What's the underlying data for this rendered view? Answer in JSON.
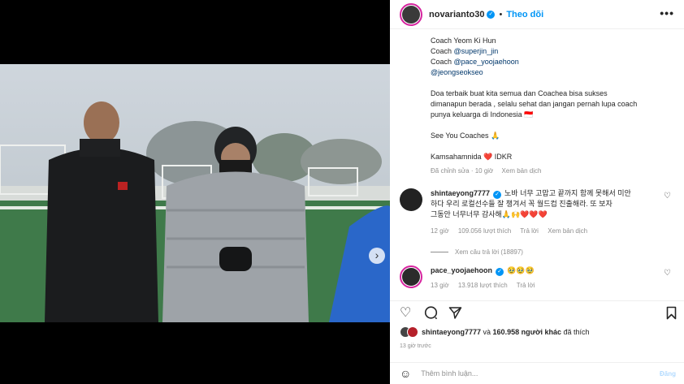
{
  "post": {
    "username": "novarianto30",
    "verified": true,
    "separator": "•",
    "follow_label": "Theo dõi",
    "more_label": "•••"
  },
  "caption": {
    "lines": [
      {
        "text": "Coach Yeom Ki Hun",
        "mention": false
      },
      {
        "text": "Coach ",
        "mention": false,
        "handle": "@superjin_jin"
      },
      {
        "text": "Coach ",
        "mention": false,
        "handle": "@pace_yoojaehoon"
      },
      {
        "text": "",
        "mention": true,
        "handle": "@jeongseokseo"
      }
    ],
    "paragraph_1": "Doa terbaik buat kita semua dan Coachea bisa sukses",
    "paragraph_2": "dimanapun berada , selalu sehat dan jangan pernah lupa coach",
    "paragraph_3": "punya keluarga di Indonesia 🇮🇩",
    "see_you": "See You Coaches 🙏",
    "kamsa": "Kamsahamnida ❤️ IDKR",
    "meta_edited": "Đã chỉnh sửa · 10 giờ",
    "meta_translate": "Xem bản dịch"
  },
  "comments": [
    {
      "username": "shintaeyong7777",
      "verified": true,
      "text_1": "노바 너무 고맙고 끝까지 함께 못해서 미안",
      "text_2": "하다 우리 로컬선수들 잘 챙겨서 꼭 월드컵 진출해라. 또 보자",
      "text_3": "그동안 너무너무 감사해🙏🙌❤️❤️❤️",
      "time": "12 giờ",
      "likes": "109.056 lượt thích",
      "reply": "Trả lời",
      "translate": "Xem bản dịch",
      "replies": "Xem câu trả lời (18897)"
    },
    {
      "username": "pace_yoojaehoon",
      "verified": true,
      "text": "🥹🥹🥹",
      "time": "13 giờ",
      "likes": "13.918 lượt thích",
      "reply": "Trả lời"
    }
  ],
  "likes_summary": {
    "user": "shintaeyong7777",
    "and": " và ",
    "others": "160.958 người khác",
    "suffix": " đã thích"
  },
  "timestamp": "13 giờ trước",
  "add_comment": {
    "placeholder": "Thêm bình luận...",
    "post_label": "Đăng"
  },
  "colors": {
    "accent": "#0095f6",
    "like_red": "#ed4956",
    "ring": "#d6249f"
  },
  "carousel": {
    "slide_count": 9,
    "active_index": 0
  }
}
